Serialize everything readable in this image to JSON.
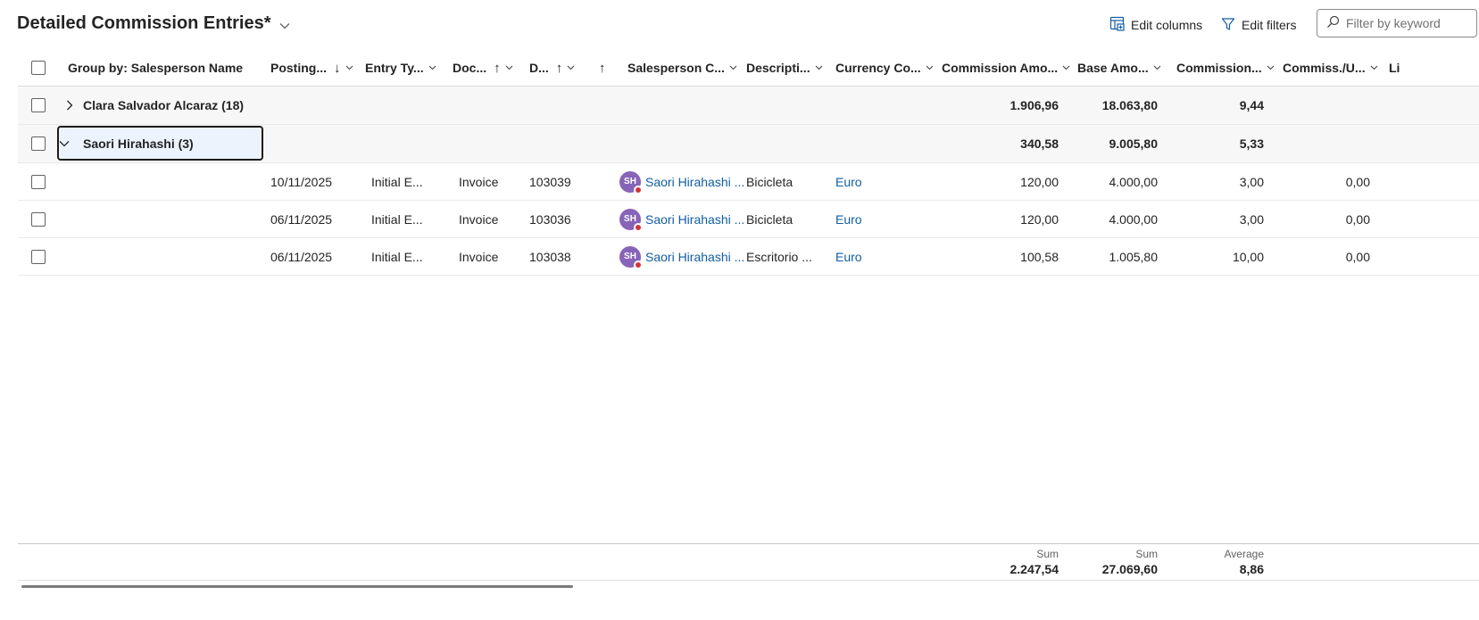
{
  "page": {
    "title": "Detailed Commission Entries*",
    "edit_columns_label": "Edit columns",
    "edit_filters_label": "Edit filters",
    "search_placeholder": "Filter by keyword"
  },
  "columns": {
    "group_by": "Group by: Salesperson Name",
    "posting": "Posting...",
    "entry_type": "Entry Ty...",
    "doc_type": "Doc...",
    "doc_no": "D...",
    "sort_arrow": "↑",
    "salesperson_code": "Salesperson C...",
    "description": "Descripti...",
    "currency_code": "Currency Co...",
    "commission_amount": "Commission Amo...",
    "base_amount": "Base Amo...",
    "commission_pct": "Commission...",
    "commiss_unit": "Commiss./U...",
    "overflow": "Li"
  },
  "groups": [
    {
      "label": "Clara Salvador Alcaraz (18)",
      "expanded": false,
      "commission_amount": "1.906,96",
      "base_amount": "18.063,80",
      "commission_pct": "9,44"
    },
    {
      "label": "Saori Hirahashi (3)",
      "expanded": true,
      "commission_amount": "340,58",
      "base_amount": "9.005,80",
      "commission_pct": "5,33"
    }
  ],
  "rows": [
    {
      "posting_date": "10/11/2025",
      "entry_type": "Initial E...",
      "doc_type": "Invoice",
      "doc_no": "103039",
      "avatar_initials": "SH",
      "salesperson": "Saori Hirahashi ...",
      "description": "Bicicleta",
      "currency": "Euro",
      "commission_amount": "120,00",
      "base_amount": "4.000,00",
      "commission_pct": "3,00",
      "commiss_unit": "0,00"
    },
    {
      "posting_date": "06/11/2025",
      "entry_type": "Initial E...",
      "doc_type": "Invoice",
      "doc_no": "103036",
      "avatar_initials": "SH",
      "salesperson": "Saori Hirahashi ...",
      "description": "Bicicleta",
      "currency": "Euro",
      "commission_amount": "120,00",
      "base_amount": "4.000,00",
      "commission_pct": "3,00",
      "commiss_unit": "0,00"
    },
    {
      "posting_date": "06/11/2025",
      "entry_type": "Initial E...",
      "doc_type": "Invoice",
      "doc_no": "103038",
      "avatar_initials": "SH",
      "salesperson": "Saori Hirahashi ...",
      "description": "Escritorio ...",
      "currency": "Euro",
      "commission_amount": "100,58",
      "base_amount": "1.005,80",
      "commission_pct": "10,00",
      "commiss_unit": "0,00"
    }
  ],
  "footer": {
    "commission_amount": {
      "label": "Sum",
      "value": "2.247,54"
    },
    "base_amount": {
      "label": "Sum",
      "value": "27.069,60"
    },
    "commission_pct": {
      "label": "Average",
      "value": "8,86"
    }
  },
  "icons": {
    "title_chevron": "chevron-down-icon",
    "edit_columns": "edit-columns-icon",
    "edit_filters": "filter-icon",
    "search": "search-icon",
    "group_collapsed": "chevron-right-icon",
    "group_expanded": "chevron-down-icon",
    "sort": "sort-arrow-icon"
  },
  "colors": {
    "link": "#115ea3",
    "avatar": "#8764b8",
    "presence_busy": "#d13438",
    "selected_cell_bg": "#ebf3fc",
    "group_row_bg": "#f7f7f7"
  }
}
